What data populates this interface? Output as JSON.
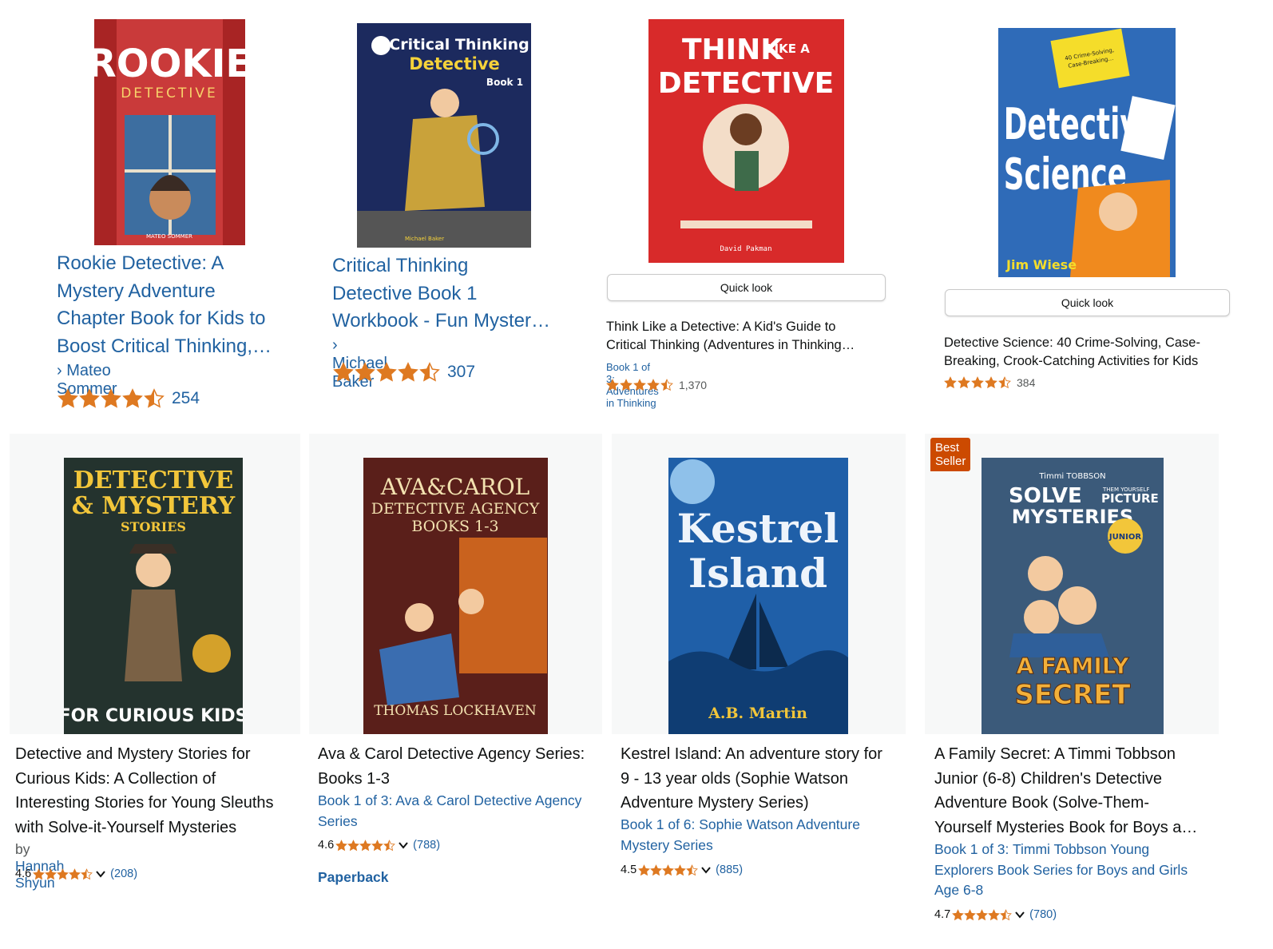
{
  "top": [
    {
      "title": "Rookie Detective: A Mystery Adventure Chapter Book for Kids to Boost Critical Thinking,…",
      "title_lines": [
        "Rookie Detective: A",
        "Mystery Adventure",
        "Chapter Book for Kids to",
        "Boost Critical Thinking,…"
      ],
      "author": "› Mateo Sommer",
      "rating": 4.5,
      "reviews": "254",
      "cover": {
        "top": "ROOKIE",
        "sub": "DETECTIVE",
        "author": "MATEO SOMMER",
        "bg": "#c93a3a"
      }
    },
    {
      "title_lines": [
        "Critical Thinking",
        "Detective Book 1",
        "Workbook - Fun Myster…"
      ],
      "author": "› Michael Baker",
      "rating": 4.5,
      "reviews": "307",
      "cover": {
        "line1": "Critical Thinking",
        "line2": "Detective",
        "line3": "Book 1",
        "author": "Michael Baker",
        "bg": "#1c2a5e"
      }
    },
    {
      "quick_look": "Quick look",
      "title_lines": [
        "Think Like a Detective: A Kid's Guide to",
        "Critical Thinking (Adventures in Thinking…"
      ],
      "series": "Book 1 of 3: Adventures in Thinking",
      "rating": 4.5,
      "reviews": "1,370",
      "cover": {
        "line1": "THINK",
        "small": "LIKE A",
        "line2": "DETECTIVE",
        "author": "David Pakman",
        "bg": "#d82a2a"
      }
    },
    {
      "quick_look": "Quick look",
      "title_lines": [
        "Detective Science: 40 Crime-Solving, Case-",
        "Breaking, Crook-Catching Activities for Kids"
      ],
      "rating": 4.5,
      "reviews": "384",
      "cover": {
        "line1": "Detective",
        "line2": "Science",
        "tag": "40 Crime-Solving, Case-Breaking, Crook-Catching Activities for Kids",
        "author": "Jim Wiese",
        "bg": "#2f6bb8"
      }
    }
  ],
  "bottom": [
    {
      "title_lines": [
        "Detective and Mystery Stories for",
        "Curious Kids: A Collection of",
        "Interesting Stories for Young Sleuths",
        "with Solve-it-Yourself Mysteries"
      ],
      "by_prefix": "by",
      "author": "Hannah Shyun",
      "rating_value": "4.6",
      "rating": 4.5,
      "reviews": "(208)",
      "cover": {
        "line1": "DETECTIVE",
        "line2": "& MYSTERY",
        "line3": "STORIES",
        "bottom": "FOR CURIOUS KIDS",
        "bg": "#24332e"
      }
    },
    {
      "title_lines": [
        "Ava & Carol Detective Agency Series:",
        "Books 1-3"
      ],
      "series_lines": [
        "Book 1 of 3: Ava & Carol Detective Agency",
        "Series"
      ],
      "rating_value": "4.6",
      "rating": 4.5,
      "reviews": "(788)",
      "format": "Paperback",
      "cover": {
        "line1": "AVA&CAROL",
        "line2": "DETECTIVE AGENCY",
        "line3": "BOOKS 1-3",
        "author": "THOMAS LOCKHAVEN",
        "bg": "#5a1f1a"
      }
    },
    {
      "title_lines": [
        "Kestrel Island: An adventure story for",
        "9 - 13 year olds (Sophie Watson",
        "Adventure Mystery Series)"
      ],
      "series_lines": [
        "Book 1 of 6: Sophie Watson Adventure",
        "Mystery Series"
      ],
      "rating_value": "4.5",
      "rating": 4.5,
      "reviews": "(885)",
      "cover": {
        "line1": "Kestrel",
        "line2": "Island",
        "author": "A.B. Martin",
        "bg": "#1f5fa8"
      }
    },
    {
      "badge": "Best Seller",
      "title_lines": [
        "A Family Secret: A Timmi Tobbson",
        "Junior (6-8) Children's Detective",
        "Adventure Book (Solve-Them-",
        "Yourself Mysteries Book for Boys a…"
      ],
      "series_lines": [
        "Book 1 of 3: Timmi Tobbson Young",
        "Explorers Book Series for Boys and Girls",
        "Age 6-8"
      ],
      "rating_value": "4.7",
      "rating": 4.5,
      "reviews": "(780)",
      "cover": {
        "top": "Timmi TOBBSON",
        "line1": "SOLVE",
        "line1b": "THEM YOURSELF",
        "line1c": "PICTURE",
        "line2": "MYSTERIES",
        "junior": "JUNIOR",
        "line3": "A FAMILY",
        "line4": "SECRET",
        "bg": "#3b5a7a"
      }
    }
  ],
  "colors": {
    "link": "#2162a1",
    "star": "#de7921",
    "badge": "#cc4a00"
  },
  "icons": {
    "star": "star-icon",
    "chevron": "chevron-down-icon"
  }
}
